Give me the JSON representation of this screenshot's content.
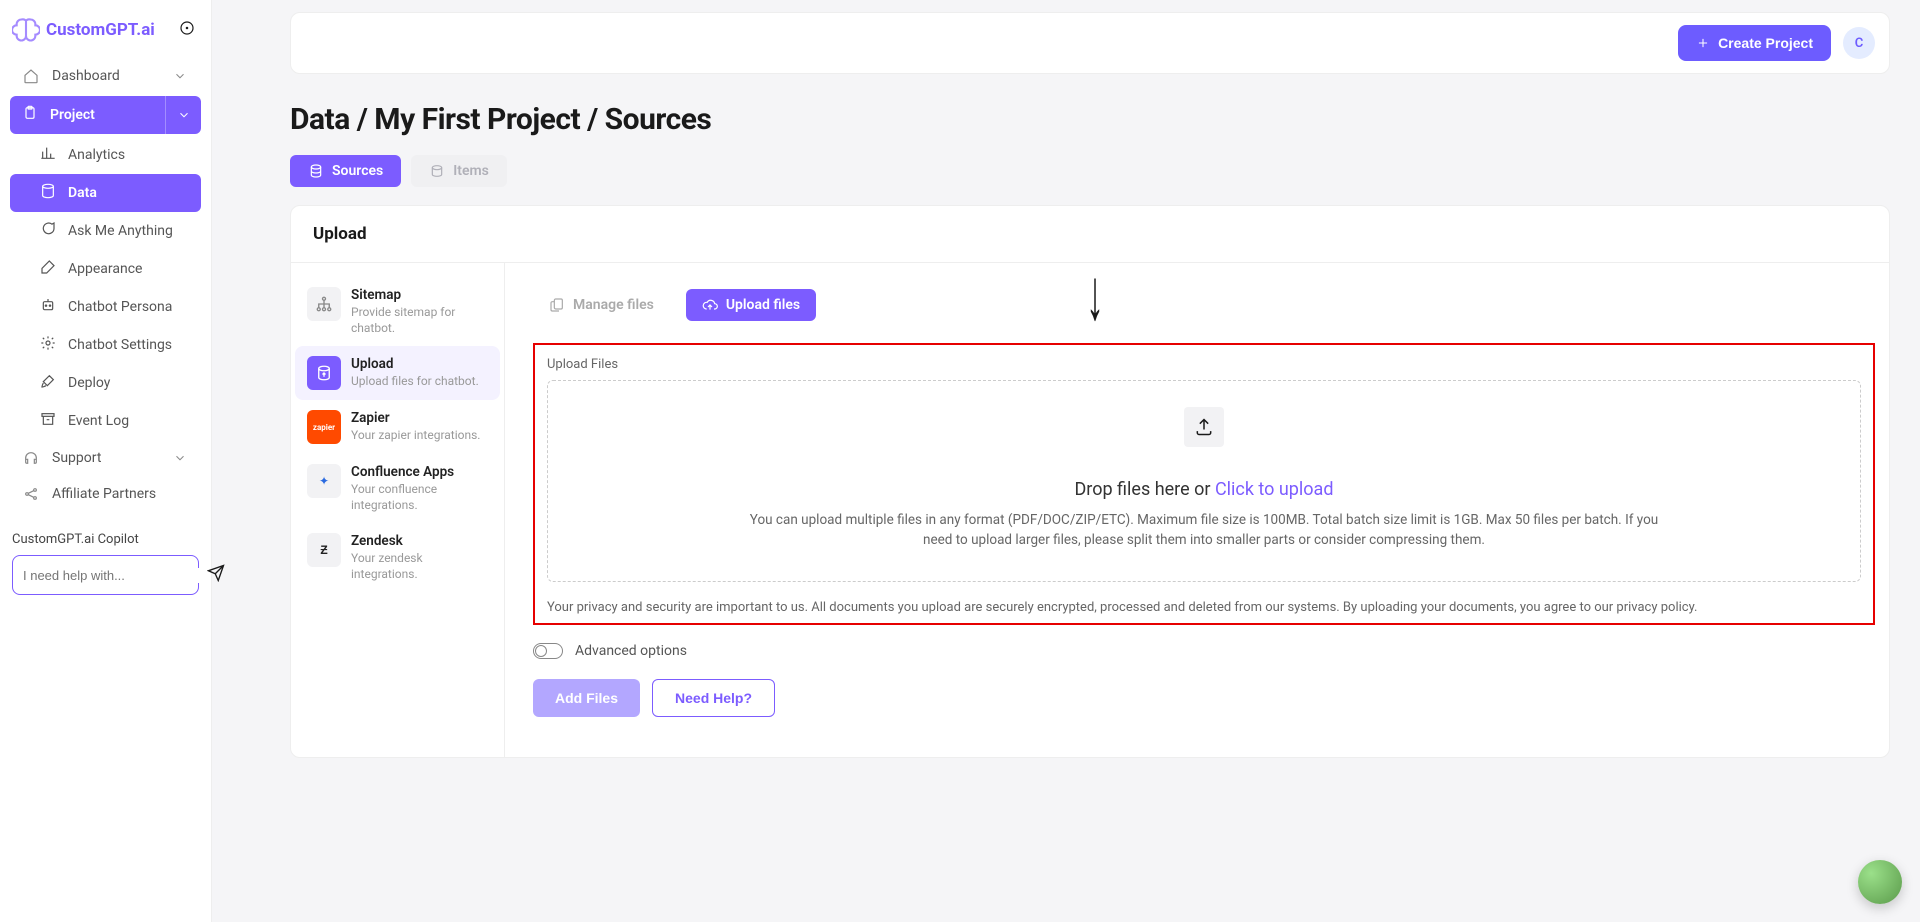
{
  "brand": "CustomGPT.ai",
  "header": {
    "create_label": "Create Project",
    "avatar_initial": "C"
  },
  "nav": {
    "dashboard": "Dashboard",
    "project": "Project",
    "analytics": "Analytics",
    "data": "Data",
    "ask": "Ask Me Anything",
    "appearance": "Appearance",
    "persona": "Chatbot Persona",
    "settings": "Chatbot Settings",
    "deploy": "Deploy",
    "eventlog": "Event Log",
    "support": "Support",
    "affiliate": "Affiliate Partners"
  },
  "copilot": {
    "title": "CustomGPT.ai Copilot",
    "placeholder": "I need help with..."
  },
  "breadcrumb": "Data / My First Project / Sources",
  "tabs": {
    "sources": "Sources",
    "items": "Items"
  },
  "panel_title": "Upload",
  "sources": {
    "sitemap": {
      "title": "Sitemap",
      "desc": "Provide sitemap for chatbot."
    },
    "upload": {
      "title": "Upload",
      "desc": "Upload files for chatbot."
    },
    "zapier": {
      "title": "Zapier",
      "desc": "Your zapier integrations.",
      "badge": "zapier"
    },
    "confluence": {
      "title": "Confluence Apps",
      "desc": "Your confluence integrations."
    },
    "zendesk": {
      "title": "Zendesk",
      "desc": "Your zendesk integrations."
    }
  },
  "file_tabs": {
    "manage": "Manage files",
    "upload": "Upload files"
  },
  "upload_area": {
    "label": "Upload Files",
    "drop_prefix": "Drop files here or ",
    "drop_link": "Click to upload",
    "help": "You can upload multiple files in any format (PDF/DOC/ZIP/ETC). Maximum file size is 100MB. Total batch size limit is 1GB. Max 50 files per batch. If you need to upload larger files, please split them into smaller parts or consider compressing them.",
    "privacy": "Your privacy and security are important to us. All documents you upload are securely encrypted, processed and deleted from our systems. By uploading your documents, you agree to our privacy policy."
  },
  "advanced_label": "Advanced options",
  "actions": {
    "add_files": "Add Files",
    "need_help": "Need Help?"
  }
}
